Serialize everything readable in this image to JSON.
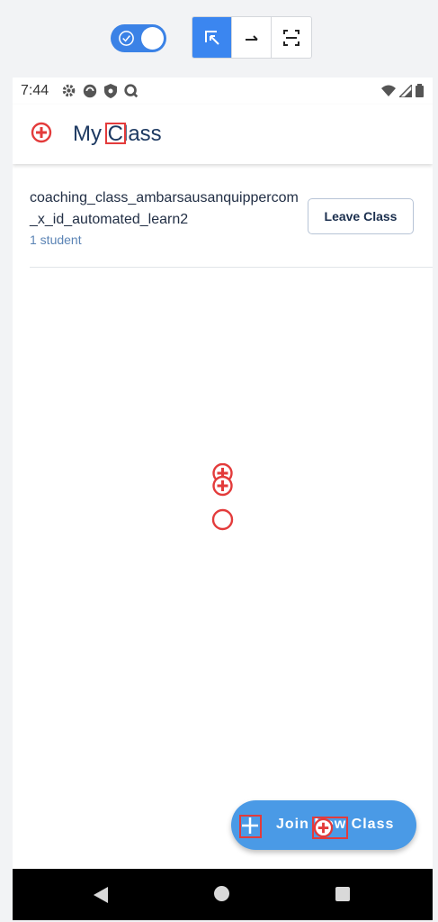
{
  "toolbar": {
    "toggle_state": "on",
    "tools": [
      "select-tool",
      "swipe-tool",
      "screenshot-tool"
    ]
  },
  "status_bar": {
    "time": "7:44"
  },
  "app_bar": {
    "title": "My Class"
  },
  "classes": [
    {
      "name": "coaching_class_ambarsausanquippercom_x_id_automated_learn2",
      "students": "1 student",
      "action": "Leave Class"
    }
  ],
  "fab": {
    "label": "Join New Class"
  },
  "colors": {
    "accent": "#4a9ae6",
    "title": "#1e3a62",
    "marker": "#e33b3b"
  }
}
